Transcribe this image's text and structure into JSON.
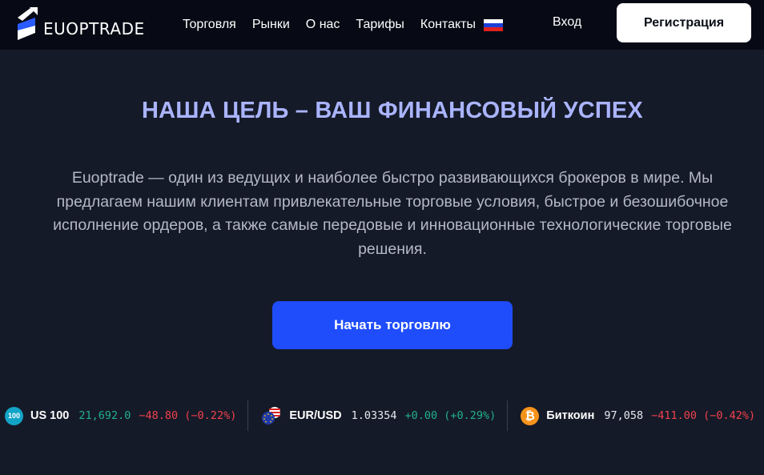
{
  "brand": {
    "name": "EUOPTRADE"
  },
  "nav": {
    "items": [
      {
        "label": "Торговля"
      },
      {
        "label": "Рынки"
      },
      {
        "label": "О нас"
      },
      {
        "label": "Тарифы"
      },
      {
        "label": "Контакты"
      }
    ],
    "language_flag": "russia-flag-icon",
    "login_label": "Вход",
    "register_label": "Регистрация"
  },
  "hero": {
    "title": "НАША ЦЕЛЬ – ВАШ ФИНАНСОВЫЙ УСПЕХ",
    "text": "Euoptrade — один из ведущих и наиболее быстро развивающихся брокеров в мире. Мы предлагаем нашим клиентам привлекательные торговые условия, быстрое и безошибочное исполнение ордеров, а также самые передовые и инновационные технологические торговые решения.",
    "cta_label": "Начать торговлю"
  },
  "ticker": [
    {
      "icon_text": "100",
      "icon": "us100-icon",
      "name": "US 100",
      "price": "21,692.0",
      "change": "−48.80 (−0.22%)",
      "price_color": "#21b08a",
      "change_color": "#f0414d"
    },
    {
      "icon": "eur-usd-flags-icon",
      "name": "EUR/USD",
      "price": "1.03354",
      "change": "+0.00 (+0.29%)",
      "price_color": "#e6e8ee",
      "change_color": "#21b08a"
    },
    {
      "icon": "bitcoin-icon",
      "name": "Биткоин",
      "price": "97,058",
      "change": "−411.00 (−0.42%)",
      "price_color": "#e6e8ee",
      "change_color": "#f0414d"
    }
  ],
  "colors": {
    "background": "#151a28",
    "header_bg": "#070a14",
    "accent_title": "#aab4ff",
    "cta_bg": "#1f4dfb"
  }
}
